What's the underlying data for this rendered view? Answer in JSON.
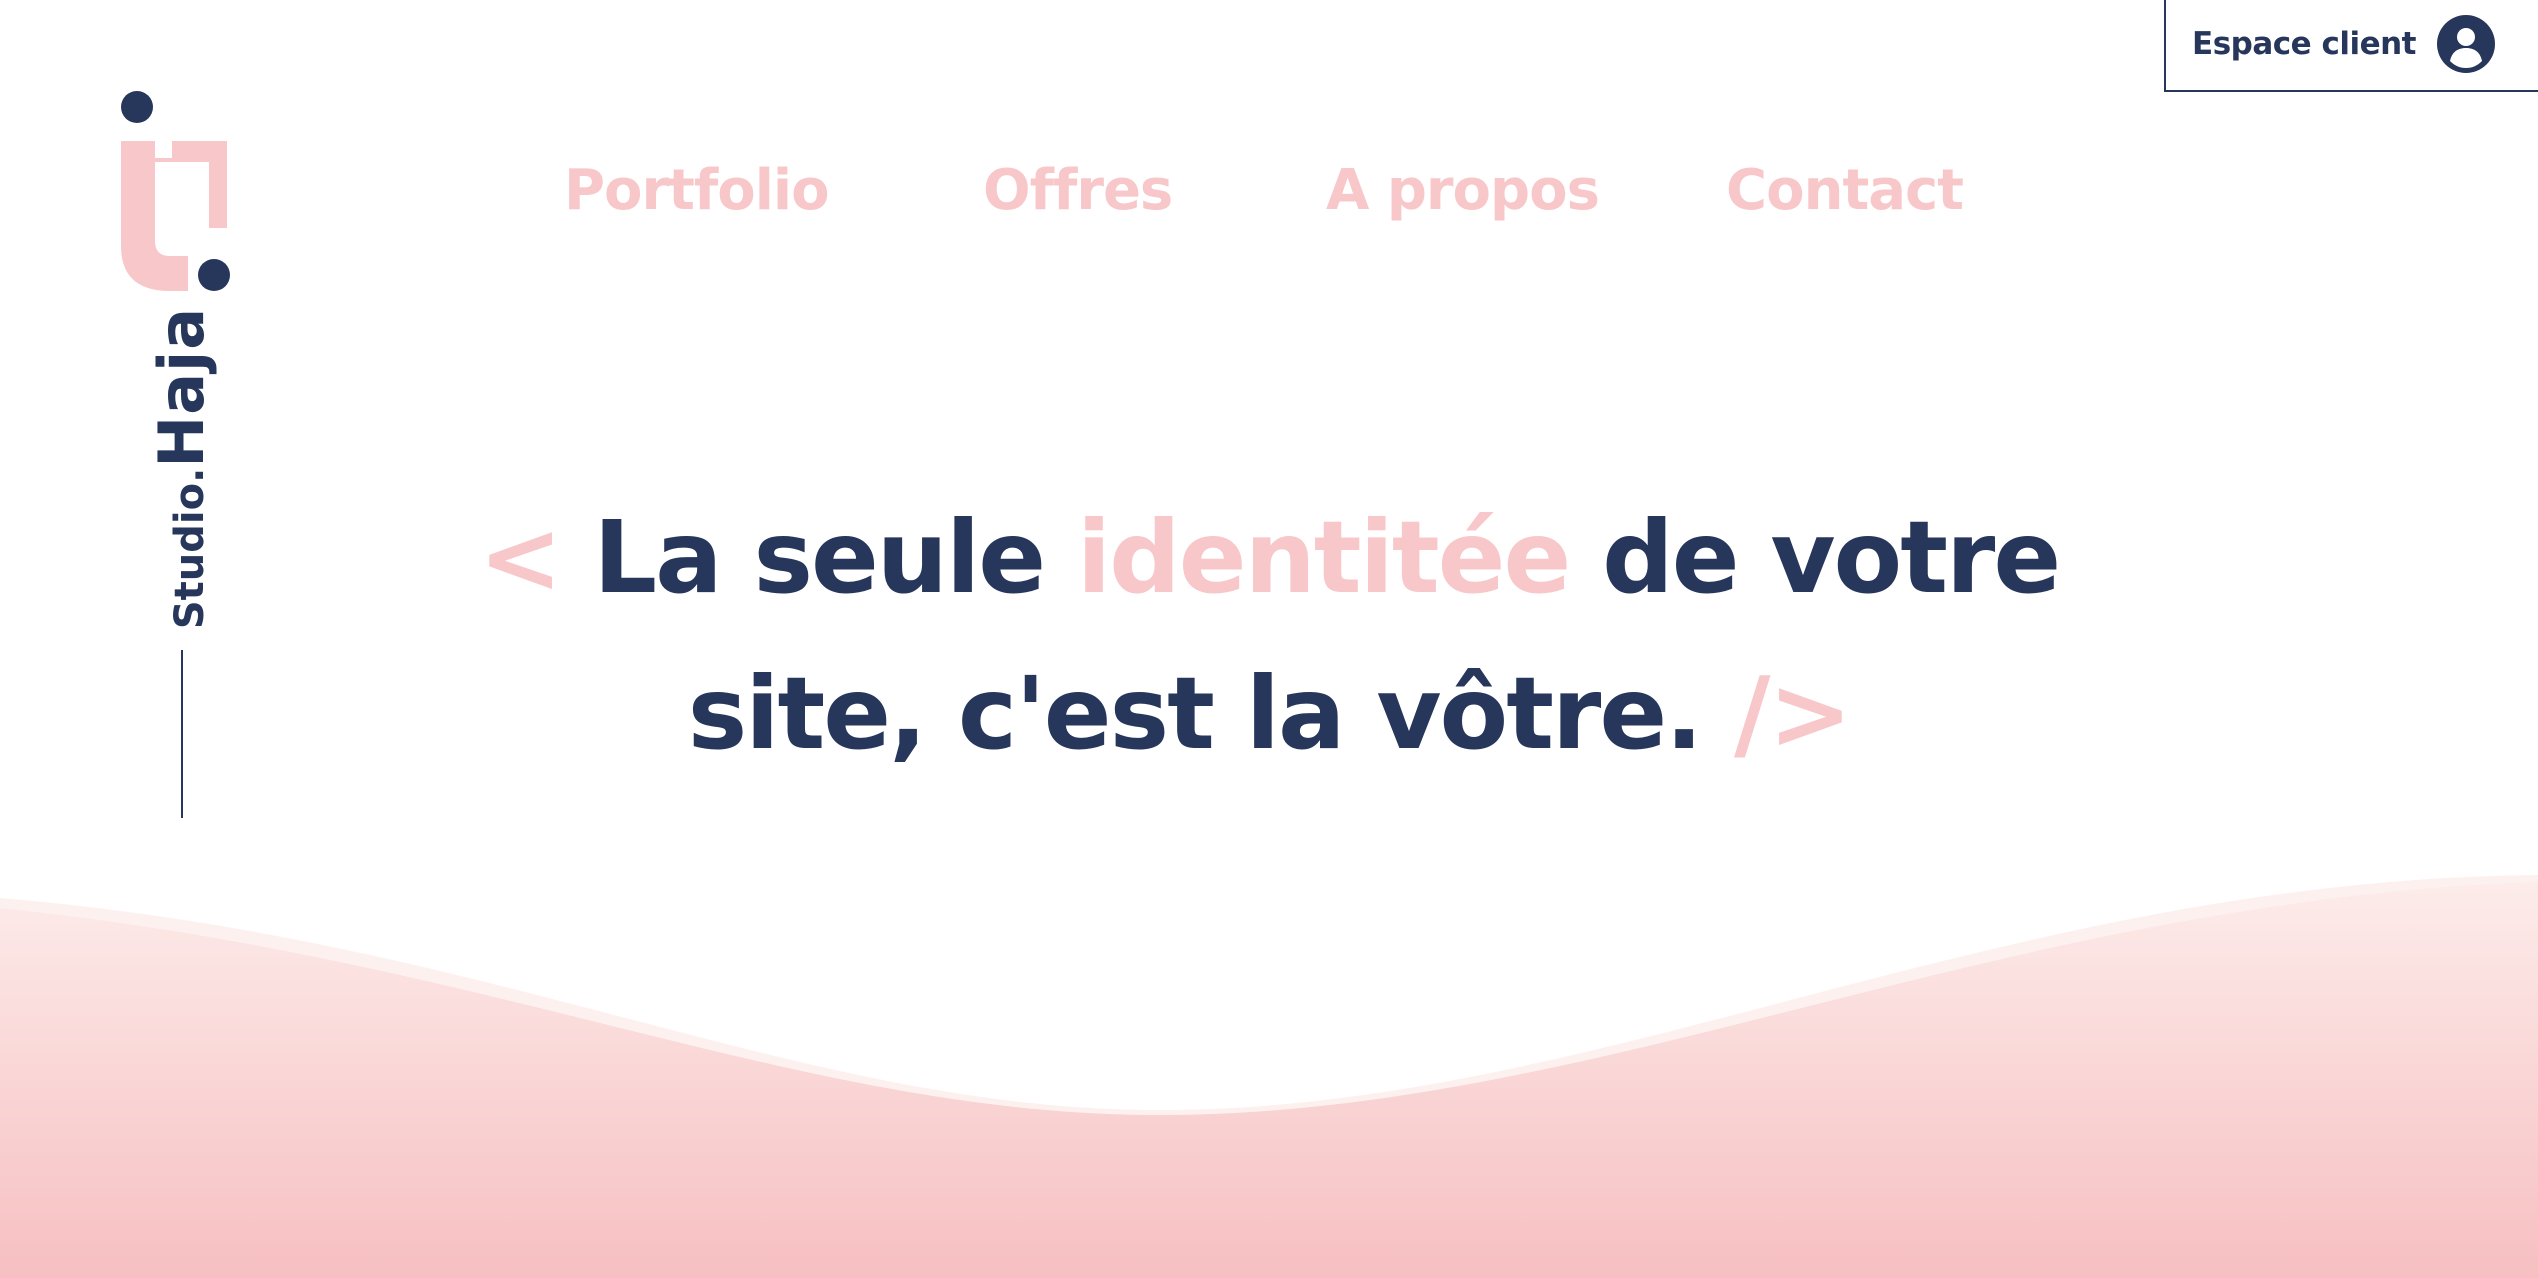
{
  "header": {
    "client_button_label": "Espace client",
    "client_icon": "user-circle-icon"
  },
  "brand": {
    "logo_icon": "studio-haja-logo",
    "studio": "Studio.",
    "name": "Haja"
  },
  "nav": {
    "items": [
      {
        "label": "Portfolio"
      },
      {
        "label": "Offres"
      },
      {
        "label": "A propos"
      },
      {
        "label": "Contact"
      }
    ]
  },
  "hero": {
    "open_tag": "<",
    "part1": "La seule",
    "highlight": "identitée",
    "part2": "de votre",
    "part3": "site, c'est la vôtre.",
    "close_tag": "/>"
  },
  "colors": {
    "navy": "#27365b",
    "pink": "#f8c7c9",
    "wave_top": "#fbe7e5",
    "wave_bottom": "#f7bfc1",
    "background": "#ffffff"
  }
}
